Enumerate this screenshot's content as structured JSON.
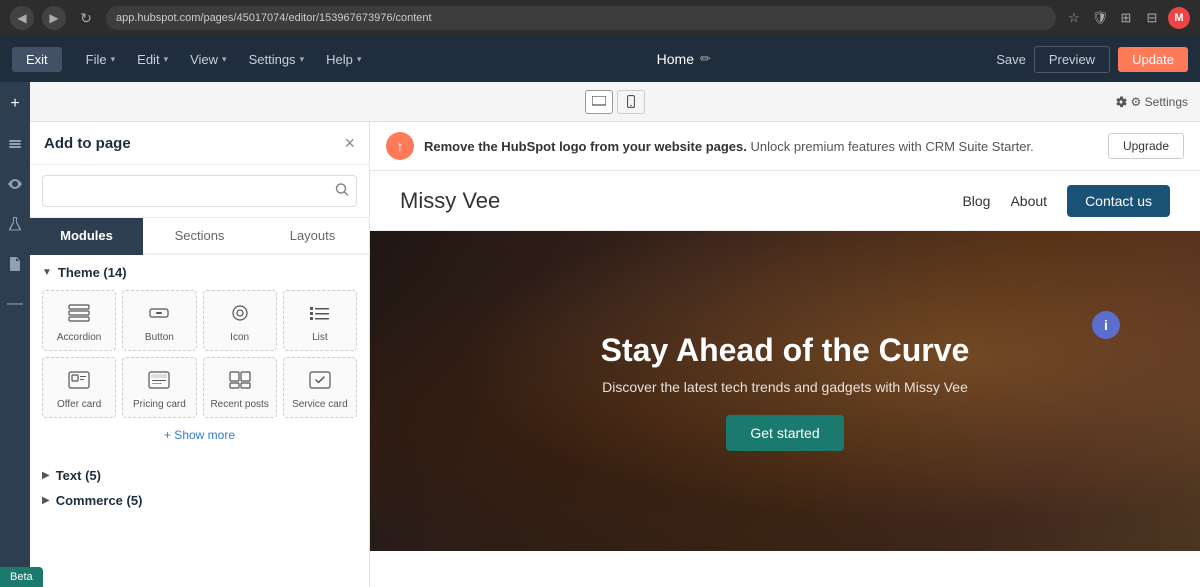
{
  "browser": {
    "url": "app.hubspot.com/pages/45017074/editor/153967673976/content",
    "back_icon": "◀",
    "forward_icon": "▶",
    "refresh_icon": "↻",
    "star_icon": "☆",
    "shield_icon": "⊕",
    "puzzle_icon": "⊞",
    "window_icon": "⊟",
    "user_initial": "M"
  },
  "app_header": {
    "exit_label": "Exit",
    "menus": [
      {
        "label": "File",
        "arrow": "▾"
      },
      {
        "label": "Edit",
        "arrow": "▾"
      },
      {
        "label": "View",
        "arrow": "▾"
      },
      {
        "label": "Settings",
        "arrow": "▾"
      },
      {
        "label": "Help",
        "arrow": "▾"
      }
    ],
    "page_title": "Home",
    "edit_icon": "✏",
    "save_label": "Save",
    "preview_label": "Preview",
    "update_label": "Update"
  },
  "viewport_toolbar": {
    "desktop_icon": "🖥",
    "mobile_icon": "📱",
    "settings_label": "⚙ Settings",
    "undo_icon": "↩",
    "redo_icon": "↪"
  },
  "add_panel": {
    "title": "Add to page",
    "close_icon": "×",
    "search_placeholder": "",
    "tabs": [
      {
        "label": "Modules",
        "active": true
      },
      {
        "label": "Sections",
        "active": false
      },
      {
        "label": "Layouts",
        "active": false
      }
    ],
    "theme_group": {
      "title": "Theme (14)",
      "expanded": true,
      "modules": [
        {
          "label": "Accordion",
          "icon": "☰"
        },
        {
          "label": "Button",
          "icon": "▦"
        },
        {
          "label": "Icon",
          "icon": "◎"
        },
        {
          "label": "List",
          "icon": "☰"
        },
        {
          "label": "Offer card",
          "icon": "⊡"
        },
        {
          "label": "Pricing card",
          "icon": "▤"
        },
        {
          "label": "Recent posts",
          "icon": "▦"
        },
        {
          "label": "Service card",
          "icon": "✦"
        }
      ],
      "show_more_label": "+ Show more"
    },
    "text_group": {
      "title": "Text (5)",
      "expanded": false
    },
    "commerce_group": {
      "title": "Commerce (5)",
      "expanded": false
    }
  },
  "left_sidebar": {
    "icons": [
      {
        "name": "plus-icon",
        "symbol": "+",
        "active": true
      },
      {
        "name": "layers-icon",
        "symbol": "⊟",
        "active": false
      },
      {
        "name": "eye-icon",
        "symbol": "◉",
        "active": false
      },
      {
        "name": "flask-icon",
        "symbol": "⚗",
        "active": false
      },
      {
        "name": "file-icon",
        "symbol": "☰",
        "active": false
      },
      {
        "name": "dash-icon",
        "symbol": "—",
        "active": false
      }
    ]
  },
  "notification": {
    "icon": "↑",
    "message_bold": "Remove the HubSpot logo from your website pages.",
    "message_normal": " Unlock premium features with CRM Suite Starter.",
    "upgrade_label": "Upgrade"
  },
  "site_preview": {
    "logo": "Missy Vee",
    "nav_links": [
      "Blog",
      "About"
    ],
    "contact_btn": "Contact us",
    "hero_title": "Stay Ahead of the Curve",
    "hero_subtitle": "Discover the latest tech trends and gadgets with Missy Vee",
    "hero_cta": "Get started",
    "info_symbol": "i"
  },
  "beta_badge": "Beta"
}
